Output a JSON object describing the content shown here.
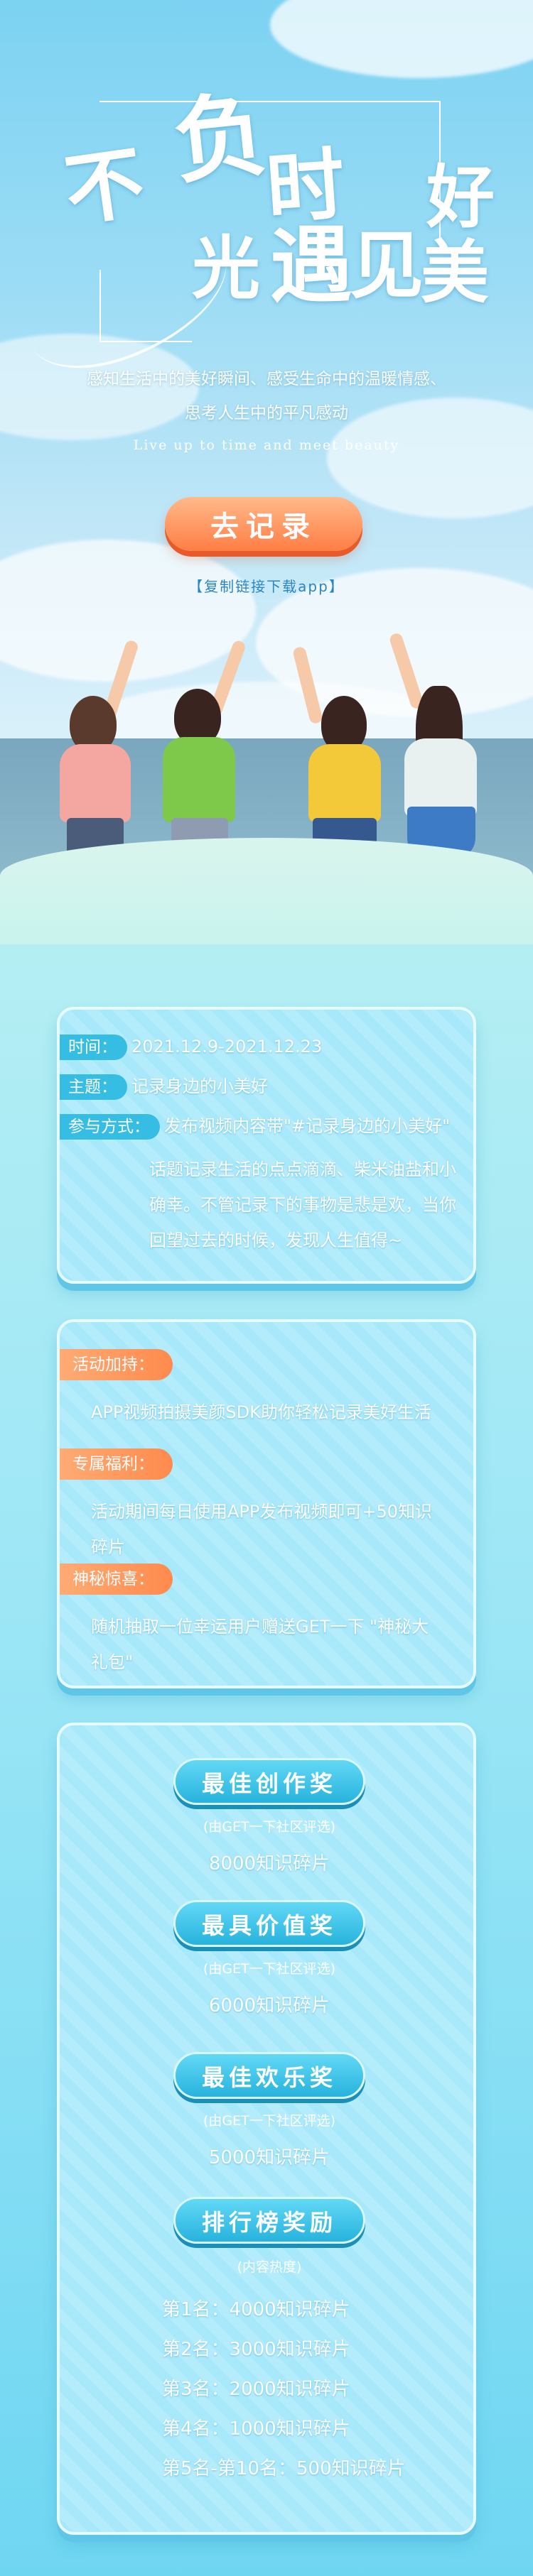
{
  "hero": {
    "title_chars": [
      "不",
      "负",
      "时",
      "光",
      "遇",
      "见",
      "美",
      "好"
    ],
    "desc_line1": "感知生活中的美好瞬间、感受生命中的温暖情感、",
    "desc_line2": "思考人生中的平凡感动",
    "english": "Live up to time and meet beauty",
    "cta_label": "去记录",
    "download_hint": "【复制链接下载app】"
  },
  "info": {
    "time_label": "时间：",
    "time_value": "2021.12.9-2021.12.23",
    "theme_label": "主题：",
    "theme_value": "记录身边的小美好",
    "method_label": "参与方式：",
    "method_value": "发布视频内容带\"#记录身边的小美好\"",
    "method_lines": [
      "话题记录生活的点点滴滴、柴米油盐和小",
      "确幸。不管记录下的事物是悲是欢，当你",
      "回望过去的时候，发现人生值得~"
    ]
  },
  "bonus": {
    "boost_label": "活动加持：",
    "boost_text": "APP视频拍摄美颜SDK助你轻松记录美好生活",
    "welfare_label": "专属福利：",
    "welfare_lines": [
      "活动期间每日使用APP发布视频即可+50知识",
      "碎片"
    ],
    "surprise_label": "神秘惊喜：",
    "surprise_lines": [
      "随机抽取一位幸运用户赠送GET一下 \"神秘大",
      "礼包\""
    ]
  },
  "awards": {
    "items": [
      {
        "title": "最佳创作奖",
        "note": "(由GET一下社区评选)",
        "prize": "8000知识碎片"
      },
      {
        "title": "最具价值奖",
        "note": "(由GET一下社区评选)",
        "prize": "6000知识碎片"
      },
      {
        "title": "最佳欢乐奖",
        "note": "(由GET一下社区评选)",
        "prize": "5000知识碎片"
      }
    ],
    "ranking": {
      "title": "排行榜奖励",
      "note": "(内容热度)",
      "ranks": [
        "第1名：4000知识碎片",
        "第2名：3000知识碎片",
        "第3名：2000知识碎片",
        "第4名：1000知识碎片",
        "第5名-第10名：500知识碎片"
      ]
    }
  },
  "colors": {
    "accent_orange": "#ff7e45",
    "accent_blue": "#27b3dd",
    "label_blue": "#35bde3"
  }
}
